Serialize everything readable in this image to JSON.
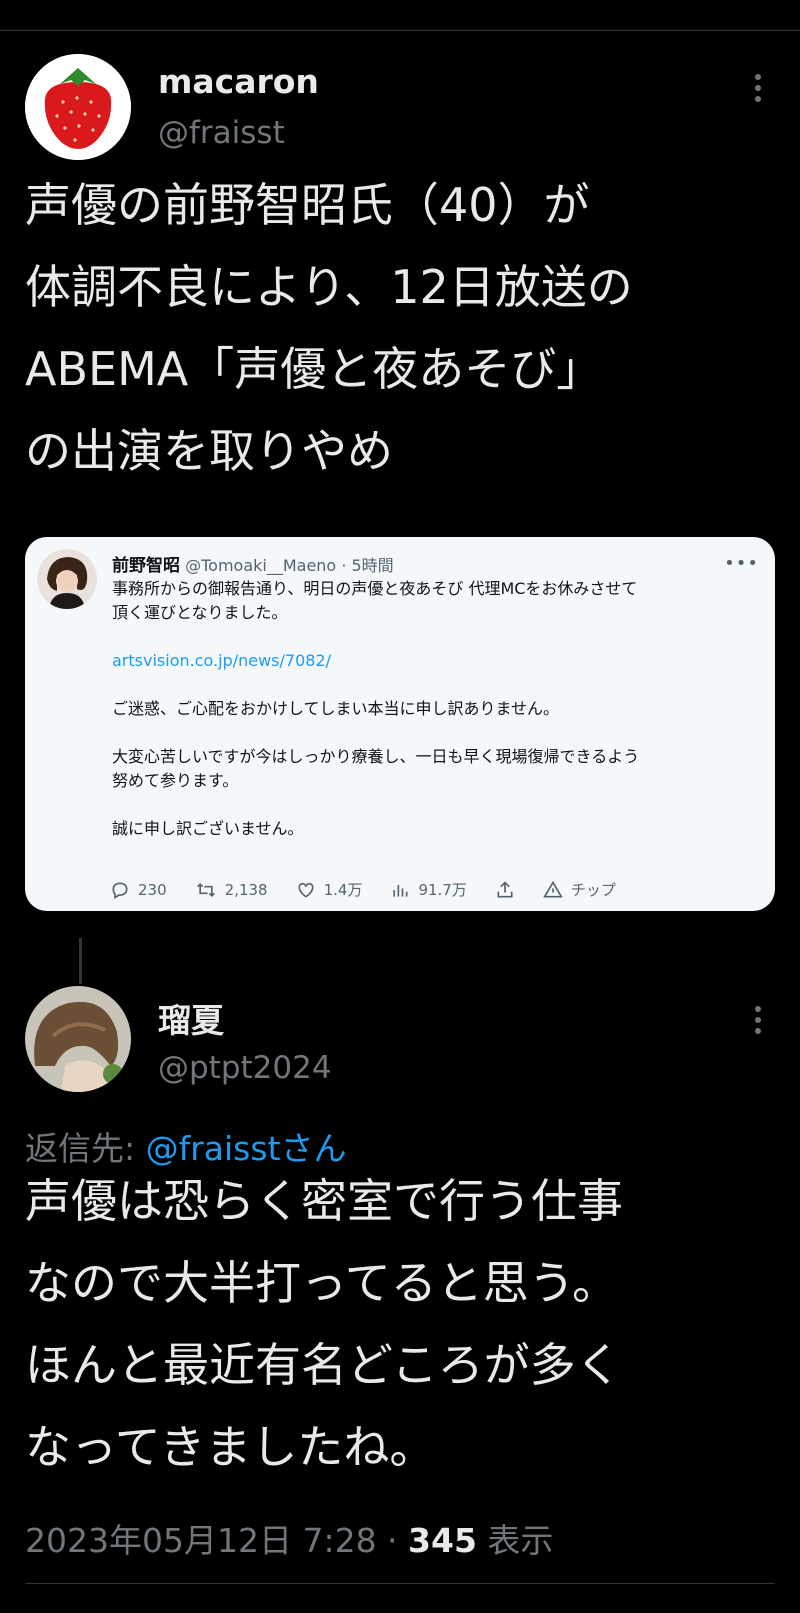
{
  "tweet1": {
    "name": "macaron",
    "handle": "@fraisst",
    "lines": [
      "声優の前野智昭氏（40）が",
      "体調不良により、12日放送の",
      "ABEMA「声優と夜あそび」",
      "の出演を取りやめ"
    ]
  },
  "card": {
    "name": "前野智昭",
    "handle": "@Tomoaki__Maeno",
    "time": "· 5時間",
    "line1": "事務所からの御報告通り、明日の声優と夜あそび 代理MCをお休みさせて",
    "line2": "頂く運びとなりました。",
    "link": "artsvision.co.jp/news/7082/",
    "line3": "ご迷惑、ご心配をおかけしてしまい本当に申し訳ありません。",
    "line4": "大変心苦しいですが今はしっかり療養し、一日も早く現場復帰できるよう",
    "line5": "努めて参ります。",
    "line6": "誠に申し訳ございません。",
    "replies": "230",
    "retweets": "2,138",
    "likes": "1.4万",
    "views": "91.7万",
    "tip": "チップ"
  },
  "tweet2": {
    "name": "瑠夏",
    "handle": "@ptpt2024",
    "reply_prefix": "返信先: ",
    "reply_mention": "@fraisstさん",
    "lines": [
      "声優は恐らく密室で行う仕事",
      "なので大半打ってると思う。",
      "ほんと最近有名どころが多く",
      "なってきましたね。"
    ],
    "timestamp": "2023年05月12日 7:28 · ",
    "views": "345",
    "views_label": " 表示"
  },
  "icons": [
    "more-icon",
    "reply-icon",
    "retweet-icon",
    "like-icon",
    "views-icon",
    "share-icon",
    "tip-icon"
  ],
  "colors": {
    "background": "#000000",
    "text": "#e7e9ea",
    "muted": "#71767b",
    "link": "#1d9bf0"
  }
}
